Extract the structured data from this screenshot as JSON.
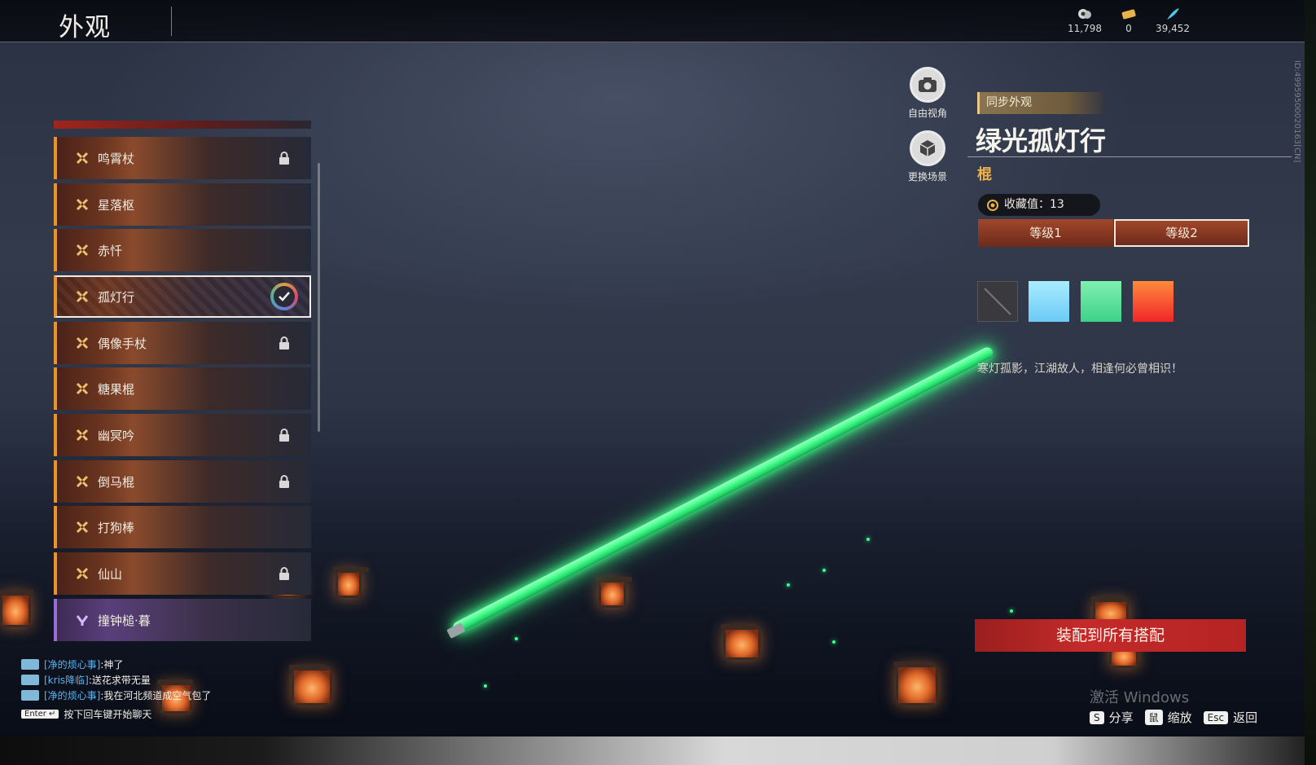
{
  "header": {
    "title": "外观"
  },
  "currencies": [
    {
      "icon": "coin-icon",
      "value": "11,798"
    },
    {
      "icon": "ticket-icon",
      "value": "0"
    },
    {
      "icon": "feather-icon",
      "value": "39,452"
    }
  ],
  "side_id": "ID:49959500020163[CN]",
  "weapon_list": [
    {
      "label": "鸣霄杖",
      "locked": true
    },
    {
      "label": "星落枢",
      "locked": false
    },
    {
      "label": "赤忏",
      "locked": false
    },
    {
      "label": "孤灯行",
      "locked": false,
      "selected": true
    },
    {
      "label": "偶像手杖",
      "locked": true
    },
    {
      "label": "糖果棍",
      "locked": false
    },
    {
      "label": "幽冥吟",
      "locked": true
    },
    {
      "label": "倒马棍",
      "locked": true
    },
    {
      "label": "打狗棒",
      "locked": false
    },
    {
      "label": "仙山",
      "locked": true
    },
    {
      "label": "撞钟槌·暮",
      "locked": false,
      "rarity": "purple"
    }
  ],
  "camera_controls": {
    "free_view": "自由视角",
    "change_scene": "更换场景"
  },
  "detail": {
    "sync_tag": "同步外观",
    "name": "绿光孤灯行",
    "type": "棍",
    "collect_label": "收藏值：13",
    "levels": [
      "等级1",
      "等级2"
    ],
    "active_level": 1,
    "color_swatches": [
      "none",
      "#7fd8ff",
      "#4fe08f",
      "#ff4a2a"
    ],
    "description": "寒灯孤影，江湖故人，相逢何必曾相识！",
    "equip_button": "装配到所有搭配"
  },
  "chat": [
    {
      "name": "[净的烦心事]",
      "msg": ":神了"
    },
    {
      "name": "[kris降临]",
      "msg": ":送花求带无量"
    },
    {
      "name": "[净的烦心事]",
      "msg": ":我在河北频道成空气包了"
    }
  ],
  "chat_prompt": {
    "key": "Enter ↵",
    "text": "按下回车键开始聊天"
  },
  "watermark": "激活 Windows",
  "hints": [
    {
      "key": "S",
      "label": "分享"
    },
    {
      "key": "鼠",
      "label": "缩放"
    },
    {
      "key": "Esc",
      "label": "返回"
    }
  ]
}
